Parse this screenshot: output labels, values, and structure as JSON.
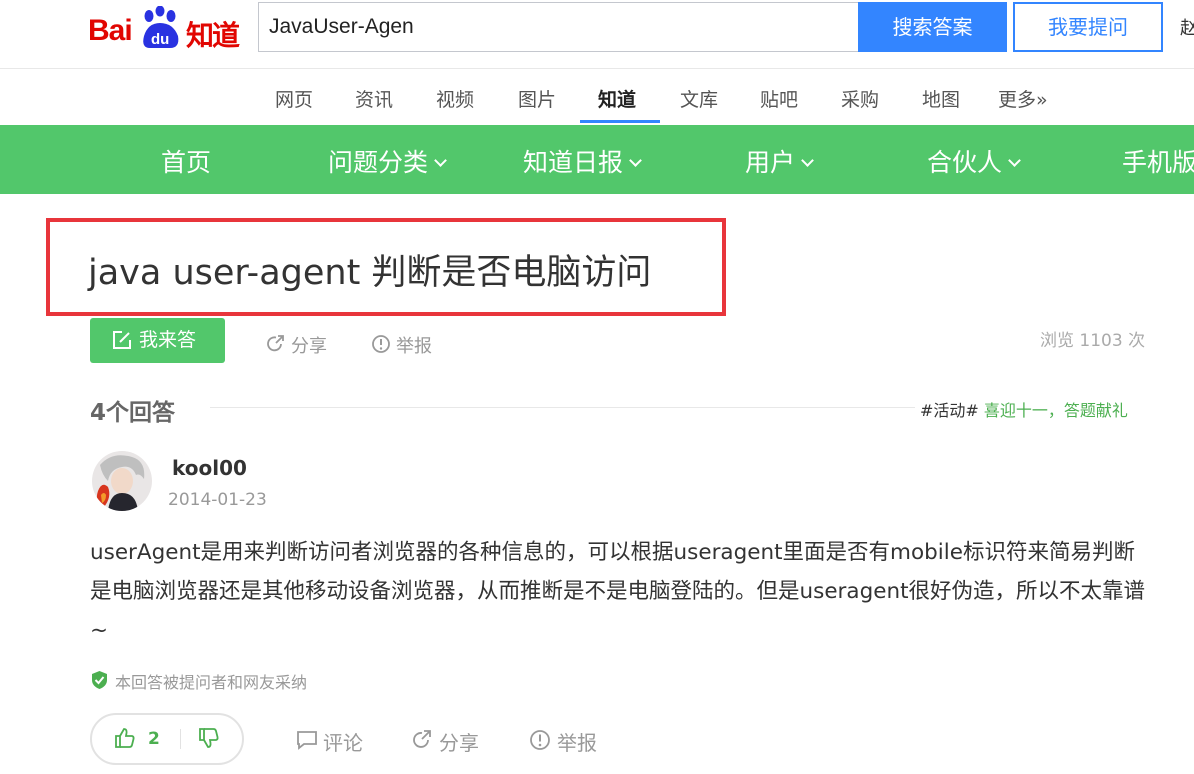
{
  "header": {
    "logo_bai": "Bai",
    "logo_du": "du",
    "logo_zhidao": "知道",
    "search_value": "JavaUser-Agen",
    "search_button": "搜索答案",
    "ask_button": "我要提问",
    "user_partial": "赵"
  },
  "nav": {
    "items": [
      "网页",
      "资讯",
      "视频",
      "图片",
      "知道",
      "文库",
      "贴吧",
      "采购",
      "地图",
      "更多»"
    ],
    "active": "知道"
  },
  "greenbar": {
    "items": [
      "首页",
      "问题分类",
      "知道日报",
      "用户",
      "合伙人",
      "手机版"
    ]
  },
  "question": {
    "title": "java user-agent 判断是否电脑访问",
    "answer_button": "我来答",
    "share": "分享",
    "report": "举报",
    "views": "浏览 1103 次"
  },
  "answers": {
    "count_label": "4个回答",
    "promo_tag": "#活动#",
    "promo_text": "喜迎十一，答题献礼"
  },
  "answer": {
    "username": "kool00",
    "date": "2014-01-23",
    "text": "userAgent是用来判断访问者浏览器的各种信息的，可以根据useragent里面是否有mobile标识符来简易判断是电脑浏览器还是其他移动设备浏览器，从而推断是不是电脑登陆的。但是useragent很好伪造，所以不太靠谱~",
    "adopted_note": "本回答被提问者和网友采纳",
    "likes": "2",
    "comment": "评论",
    "share": "分享",
    "report": "举报"
  },
  "colors": {
    "brand_red": "#e10602",
    "brand_blue": "#3385ff",
    "green": "#52c76b",
    "highlight_box": "#e8353b"
  }
}
